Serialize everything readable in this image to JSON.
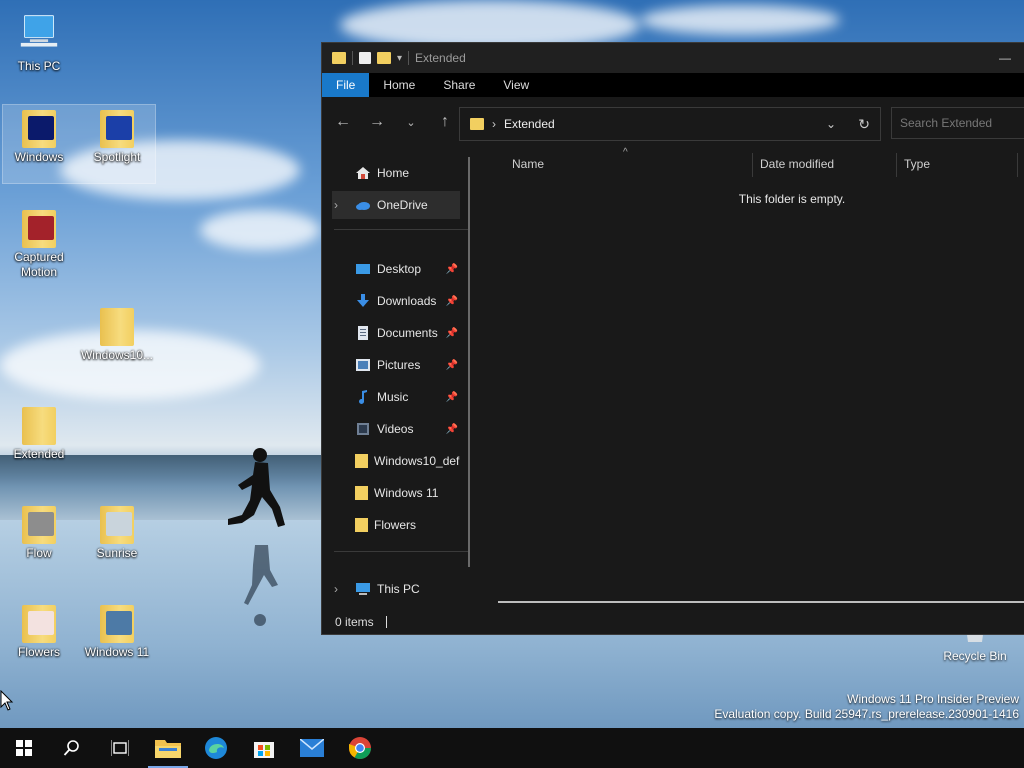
{
  "desktop": {
    "icons": [
      {
        "label": "This PC"
      },
      {
        "label": "Windows"
      },
      {
        "label": "Spotlight"
      },
      {
        "label": "Captured Motion"
      },
      {
        "label": "Windows10..."
      },
      {
        "label": "Extended"
      },
      {
        "label": "Flow"
      },
      {
        "label": "Sunrise"
      },
      {
        "label": "Flowers"
      },
      {
        "label": "Windows 11"
      }
    ],
    "recycle_bin": "Recycle Bin",
    "watermark": {
      "line1": "Windows 11 Pro Insider Preview",
      "line2": "Evaluation copy. Build 25947.rs_prerelease.230901-1416"
    }
  },
  "explorer": {
    "title": "Extended",
    "ribbon_tabs": [
      "File",
      "Home",
      "Share",
      "View"
    ],
    "address": {
      "separator": "›",
      "current": "Extended"
    },
    "search_placeholder": "Search Extended",
    "nav": {
      "home": "Home",
      "onedrive": "OneDrive",
      "pinned": [
        {
          "label": "Desktop"
        },
        {
          "label": "Downloads"
        },
        {
          "label": "Documents"
        },
        {
          "label": "Pictures"
        },
        {
          "label": "Music"
        },
        {
          "label": "Videos"
        }
      ],
      "folders": [
        {
          "label": "Windows10_def"
        },
        {
          "label": "Windows 11"
        },
        {
          "label": "Flowers"
        }
      ],
      "this_pc": "This PC"
    },
    "columns": [
      "Name",
      "Date modified",
      "Type"
    ],
    "empty_message": "This folder is empty.",
    "status": "0 items"
  },
  "colors": {
    "accent": "#1979ca",
    "window_bg": "#191919",
    "taskbar_bg": "#101010"
  }
}
